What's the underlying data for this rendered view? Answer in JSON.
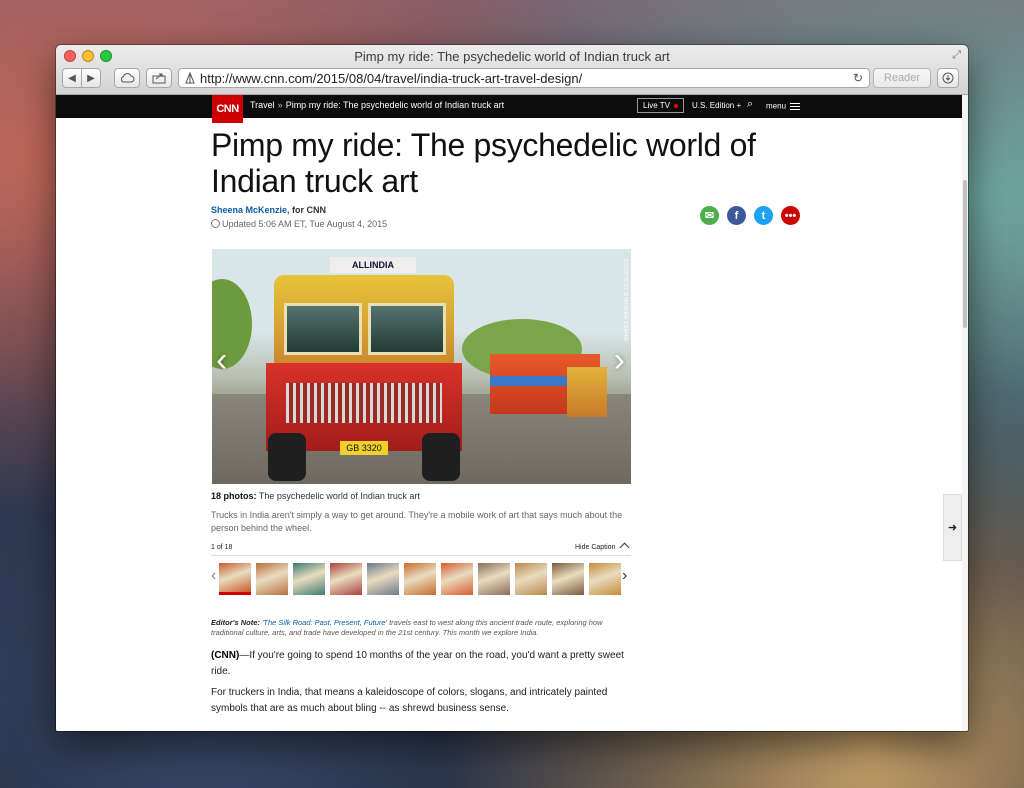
{
  "window": {
    "title": "Pimp my ride: The psychedelic world of Indian truck art",
    "url": "http://www.cnn.com/2015/08/04/travel/india-truck-art-travel-design/",
    "reader_label": "Reader"
  },
  "nav": {
    "logo": "CNN",
    "section": "Travel",
    "separator": "»",
    "breadcrumb": "Pimp my ride: The psychedelic world of Indian truck art",
    "live_tv": "Live TV",
    "edition": "U.S. Edition +",
    "menu": "menu"
  },
  "article": {
    "headline": "Pimp my ride: The psychedelic world of Indian truck art",
    "author": "Sheena McKenzie,",
    "author_suffix": " for CNN",
    "updated": "Updated 5:06 AM ET, Tue August 4, 2015"
  },
  "share": {
    "email_icon": "✉",
    "facebook_icon": "f",
    "twitter_icon": "t",
    "more_icon": "•••"
  },
  "gallery": {
    "plate_text": "GB 3320",
    "sign_text": "ALLINDIA",
    "credit": "COURTESY DINUMAN ZAMAN",
    "caption_count": "18 photos:",
    "caption_title": " The psychedelic world of Indian truck art",
    "caption_desc": "Trucks in India aren't simply a way to get around. They're a mobile work of art that says much about the person behind the wheel.",
    "counter": "1 of 18",
    "hide_caption": "Hide Caption",
    "thumb_colors": [
      "#c85a2a",
      "#b86e3e",
      "#3f7a6e",
      "#a8423a",
      "#6a7a8a",
      "#c96a2a",
      "#d85a30",
      "#8a6a5a",
      "#b88a4a",
      "#7a5a3a",
      "#c88a3a"
    ]
  },
  "body": {
    "editor_label": "Editor's Note:",
    "editor_link": "'The Silk Road: Past, Present, Future'",
    "editor_text": " travels east to west along this ancient trade route, exploring how traditional culture, arts, and trade have developed in the 21st century. This month we explore India.",
    "p1_lead": "(CNN)",
    "p1_text": "—If you're going to spend 10 months of the year on the road, you'd want a pretty sweet ride.",
    "p2_text": "For truckers in India, that means a kaleidoscope of colors, slogans, and intricately painted symbols that are as much about bling -- as shrewd business sense."
  }
}
